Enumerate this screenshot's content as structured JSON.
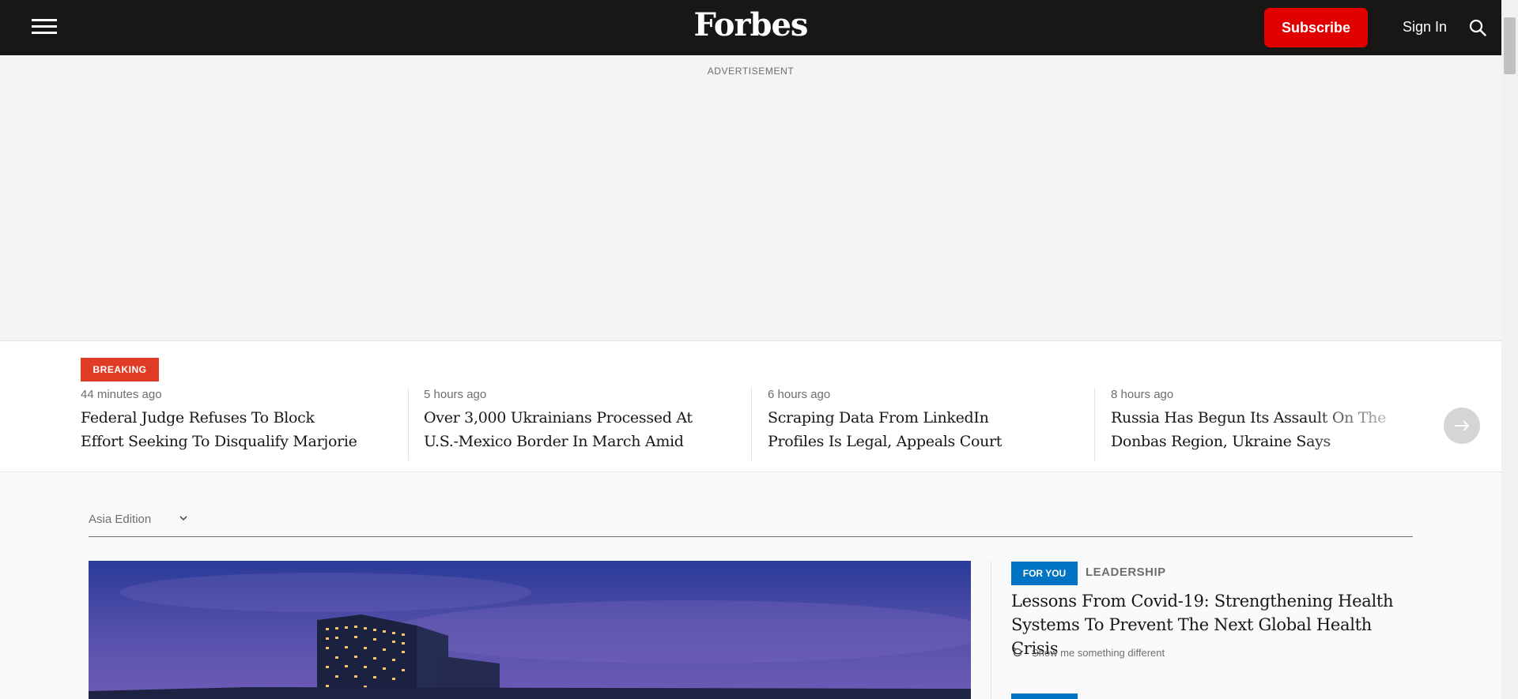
{
  "header": {
    "logo": "Forbes",
    "subscribe_label": "Subscribe",
    "signin_label": "Sign In",
    "menu_icon": "hamburger-menu-icon",
    "search_icon": "search-icon",
    "background_color": "#181716",
    "subscribe_color": "#e00000"
  },
  "ad": {
    "label": "ADVERTISEMENT"
  },
  "breaking": {
    "badge": "BREAKING",
    "badge_color": "#e03b24",
    "stories": [
      {
        "time": "44 minutes ago",
        "headline": "Federal Judge Refuses To Block Effort Seeking To Disqualify Marjorie Taylor…"
      },
      {
        "time": "5 hours ago",
        "headline": "Over 3,000 Ukrainians Processed At U.S.-Mexico Border In March Amid Migration…"
      },
      {
        "time": "6 hours ago",
        "headline": "Scraping Data From LinkedIn Profiles Is Legal, Appeals Court Rules"
      },
      {
        "time": "8 hours ago",
        "headline": "Russia Has Begun Its Assault On The Donbas Region, Ukraine Says"
      }
    ],
    "next_icon": "arrow-right-icon"
  },
  "edition": {
    "label": "Asia Edition",
    "chevron_icon": "chevron-down-icon"
  },
  "side_story": {
    "badge": "FOR YOU",
    "badge_color": "#0073c4",
    "section": "LEADERSHIP",
    "headline": "Lessons From Covid-19: Strengthening Health Systems To Prevent The Next Global Health Crisis",
    "shuffle_label": "Show me something different",
    "shuffle_icon": "refresh-icon"
  }
}
